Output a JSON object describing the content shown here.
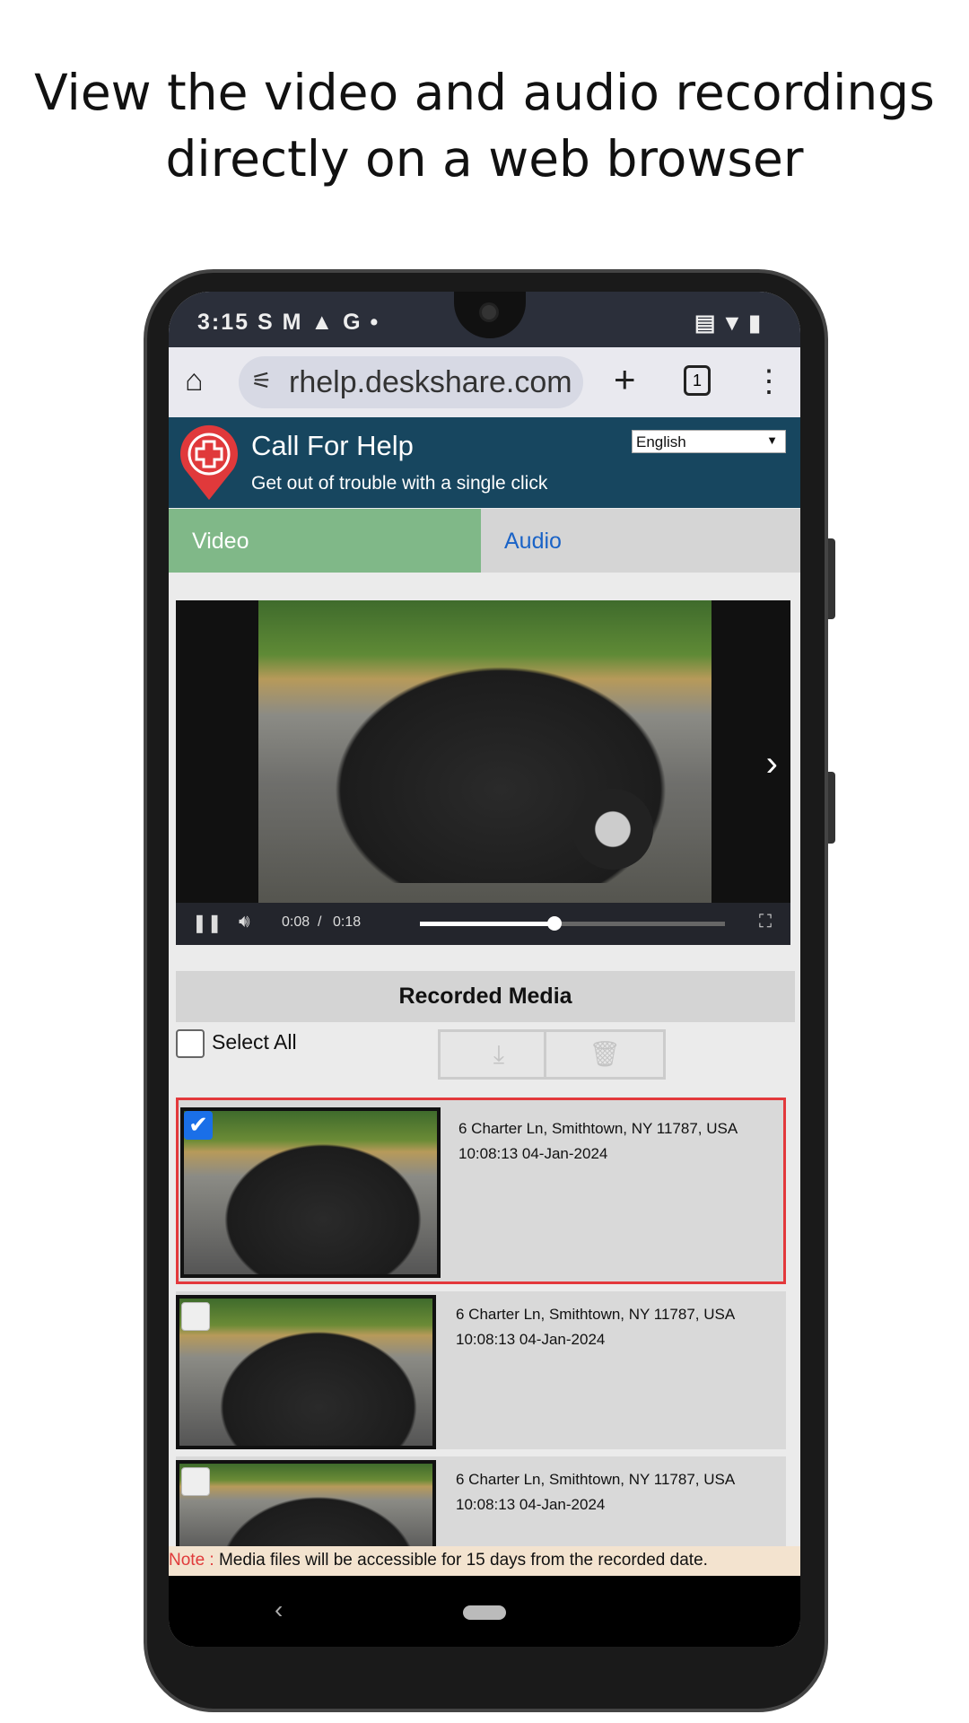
{
  "headline": {
    "line1": "View the video and audio recordings",
    "line2": "directly on a web browser"
  },
  "status": {
    "time": "3:15",
    "left_icons": "S M ▲ G •",
    "right_icons": "cast wifi battery"
  },
  "browser": {
    "url": "rhelp.deskshare.com",
    "tab_count": "1",
    "home_icon": "home-icon",
    "new_tab": "+",
    "menu": "⋮"
  },
  "header": {
    "title": "Call For Help",
    "subtitle": "Get out of trouble with a single click",
    "language": "English",
    "bg": "#17465f"
  },
  "tabs": [
    {
      "label": "Video",
      "active": true
    },
    {
      "label": "Audio",
      "active": false
    }
  ],
  "player": {
    "current": "0:08",
    "separator": "/",
    "duration": "0:18",
    "progress": 0.44
  },
  "media": {
    "title": "Recorded Media",
    "select_all": "Select All",
    "items": [
      {
        "address": "6 Charter Ln, Smithtown, NY 11787, USA",
        "time": "10:08:13 04-Jan-2024",
        "checked": true
      },
      {
        "address": "6 Charter Ln, Smithtown, NY 11787, USA",
        "time": "10:08:13 04-Jan-2024",
        "checked": false
      },
      {
        "address": "6 Charter Ln, Smithtown, NY 11787, USA",
        "time": "10:08:13 04-Jan-2024",
        "checked": false
      }
    ]
  },
  "note": {
    "key": "Note :",
    "text": " Media files will be accessible for 15 days from the recorded date."
  }
}
